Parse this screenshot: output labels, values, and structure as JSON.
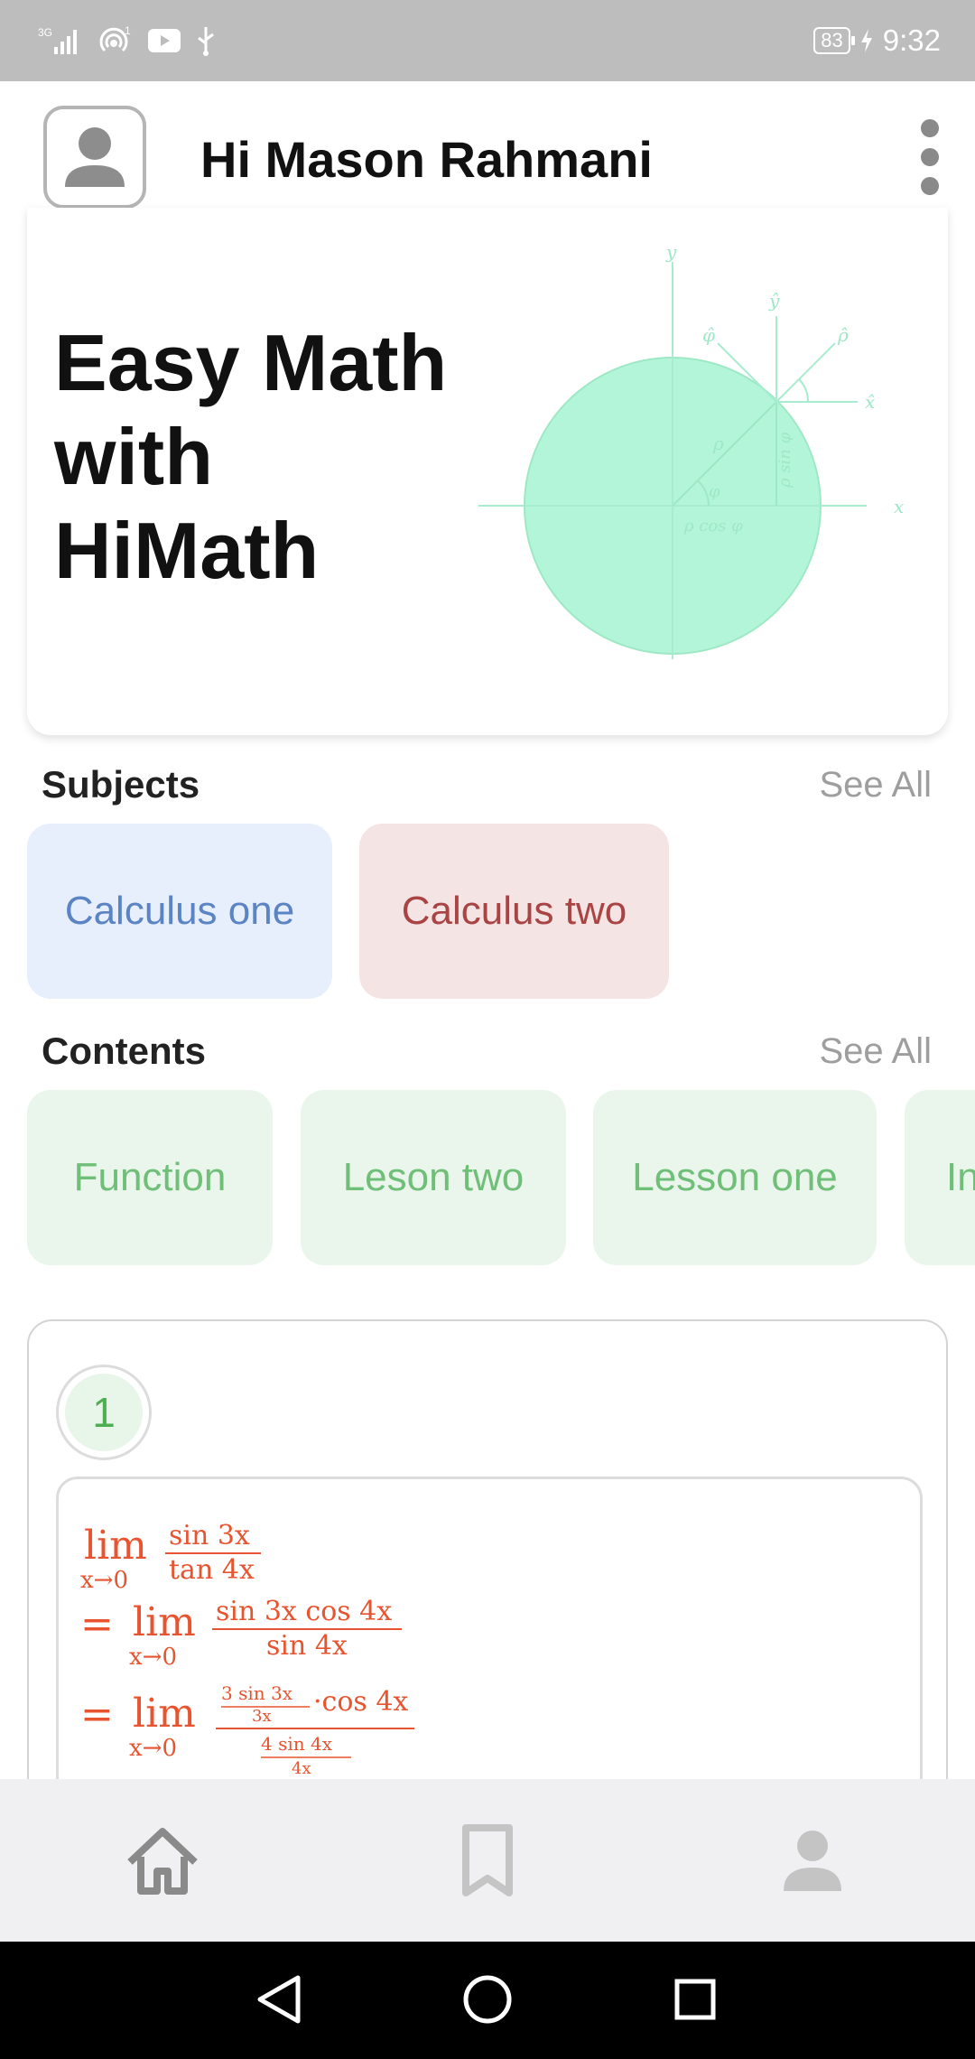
{
  "status_bar": {
    "network_label": "3G",
    "notification_count": "1",
    "battery": "83",
    "time": "9:32"
  },
  "header": {
    "greeting": "Hi Mason Rahmani"
  },
  "hero": {
    "title": "Easy Math with HiMath",
    "diagram": {
      "labels": [
        "y",
        "x",
        "ŷ",
        "x̂",
        "φ̂",
        "ρ̂",
        "ρ",
        "φ",
        "ρ cos φ",
        "ρ sin φ"
      ]
    }
  },
  "subjects": {
    "title": "Subjects",
    "see_all": "See All",
    "items": [
      {
        "label": "Calculus one",
        "bg": "#e8effc",
        "fg": "#5b84c4"
      },
      {
        "label": "Calculus two",
        "bg": "#f5e4e4",
        "fg": "#a94444"
      }
    ]
  },
  "contents": {
    "title": "Contents",
    "see_all": "See All",
    "items": [
      {
        "label": "Function"
      },
      {
        "label": "Leson two"
      },
      {
        "label": "Lesson one"
      },
      {
        "label": "In"
      }
    ]
  },
  "exercise": {
    "number": "1",
    "formula_lines": [
      "lim x→0 sin 3x / tan 4x",
      "= lim x→0 sin 3x cos 4x / sin 4x",
      "= lim x→0 (3 sin 3x / 3x · cos 4x) / (4 sin 4x / 4x)"
    ],
    "formula_color": "#e8542f"
  },
  "bottom_nav": {
    "items": [
      {
        "icon": "home-icon",
        "active": true
      },
      {
        "icon": "bookmark-icon",
        "active": false
      },
      {
        "icon": "profile-icon",
        "active": false
      }
    ]
  },
  "system_nav": {
    "items": [
      "back-icon",
      "home-circle-icon",
      "recents-icon"
    ]
  },
  "colors": {
    "status_bar": "#bdbdbd",
    "diagram_fill": "#b2f5d8",
    "content_bg": "#eaf5ec",
    "content_fg": "#6fbf78"
  }
}
